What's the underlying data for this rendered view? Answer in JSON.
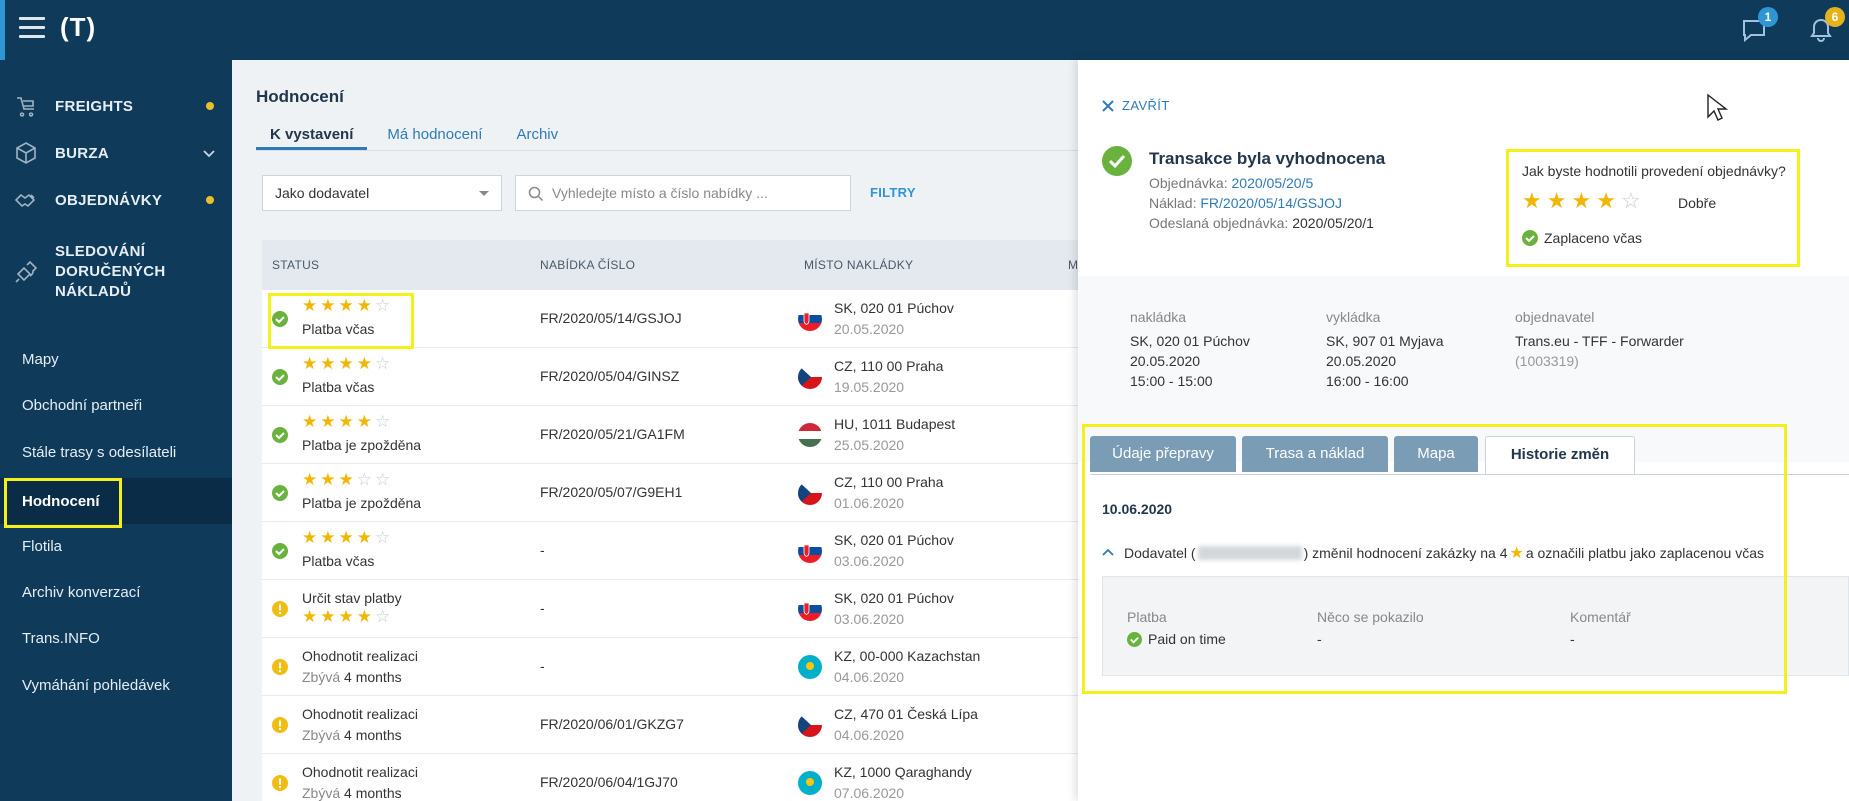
{
  "header": {
    "logo": "(T)",
    "messages_count": "1",
    "notifications_count": "6"
  },
  "sidebar": {
    "main_items": [
      {
        "label": "FREIGHTS",
        "icon": "truck-icon",
        "dot": true
      },
      {
        "label": "BURZA",
        "icon": "box-icon",
        "chevron": true
      },
      {
        "label": "OBJEDNÁVKY",
        "icon": "handshake-icon",
        "dot": true
      },
      {
        "label_lines": [
          "SLEDOVÁNÍ",
          "DORUČENÝCH",
          "NÁKLADŮ"
        ],
        "icon": "satellite-icon"
      }
    ],
    "sub_items": [
      "Mapy",
      "Obchodní partneři",
      "Stále trasy s odesílateli",
      "Hodnocení",
      "Flotila",
      "Archiv konverzací",
      "Trans.INFO",
      "Vymáhání pohledávek"
    ],
    "active_item": "Hodnocení"
  },
  "main": {
    "title": "Hodnocení",
    "tabs": [
      "K vystavení",
      "Má hodnocení",
      "Archiv"
    ],
    "role_select": "Jako dodavatel",
    "search_placeholder": "Vyhledejte místo a číslo nabídky ...",
    "filters_label": "FILTRY",
    "columns": [
      "STATUS",
      "NABÍDKA ČÍSLO",
      "MÍSTO NAKLÁDKY",
      "M"
    ],
    "rows": [
      {
        "status_icon": "check-circle-icon",
        "stars": 4,
        "status_text": "Platba včas",
        "offer": "FR/2020/05/14/GSJOJ",
        "flag": "sk",
        "location": "SK, 020 01 Púchov",
        "date": "20.05.2020",
        "next_flag": "sk"
      },
      {
        "status_icon": "check-circle-icon",
        "stars": 4,
        "status_text": "Platba včas",
        "offer": "FR/2020/05/04/GINSZ",
        "flag": "cz",
        "location": "CZ, 110 00 Praha",
        "date": "19.05.2020",
        "next_flag": "cz"
      },
      {
        "status_icon": "check-circle-icon",
        "stars": 4,
        "status_text": "Platba je zpožděna",
        "offer": "FR/2020/05/21/GA1FM",
        "flag": "hu",
        "location": "HU, 1011 Budapest",
        "date": "25.05.2020",
        "next_flag": "cz"
      },
      {
        "status_icon": "check-circle-icon",
        "stars": 3,
        "status_text": "Platba je zpožděna",
        "offer": "FR/2020/05/07/G9EH1",
        "flag": "cz",
        "location": "CZ, 110 00 Praha",
        "date": "01.06.2020",
        "next_flag": "kz"
      },
      {
        "status_icon": "check-circle-icon",
        "stars": 4,
        "status_text": "Platba včas",
        "offer": "-",
        "flag": "sk",
        "location": "SK, 020 01 Púchov",
        "date": "03.06.2020",
        "next_flag": "cz"
      },
      {
        "status_icon": "warning-circle-icon",
        "stars": 4,
        "status_text": "Určit stav platby",
        "stars_below": true,
        "offer": "-",
        "flag": "sk",
        "location": "SK, 020 01 Púchov",
        "date": "03.06.2020",
        "next_flag": "sk"
      },
      {
        "status_icon": "warning-circle-icon",
        "stars": 0,
        "status_text": "Ohodnotit realizaci",
        "remaining_label": "Zbývá",
        "remaining_value": "4 months",
        "offer": "-",
        "flag": "kz",
        "location": "KZ, 00-000 Kazachstan",
        "date": "04.06.2020",
        "next_flag": "kz"
      },
      {
        "status_icon": "warning-circle-icon",
        "stars": 0,
        "status_text": "Ohodnotit realizaci",
        "remaining_label": "Zbývá",
        "remaining_value": "4 months",
        "offer": "FR/2020/06/01/GKZG7",
        "flag": "cz",
        "location": "CZ, 470 01 Česká Lípa",
        "date": "04.06.2020",
        "next_flag": "cz"
      },
      {
        "status_icon": "warning-circle-icon",
        "stars": 0,
        "status_text": "Ohodnotit realizaci",
        "remaining_label": "Zbývá",
        "remaining_value": "4 months",
        "offer": "FR/2020/06/04/1GJ70",
        "flag": "kz",
        "location": "KZ, 1000 Qaraghandy",
        "date": "07.06.2020",
        "next_flag": "kz"
      }
    ]
  },
  "panel": {
    "close_label": "ZAVŘÍT",
    "title": "Transakce byla vyhodnocena",
    "order_label": "Objednávka:",
    "order_value": "2020/05/20/5",
    "cargo_label": "Náklad:",
    "cargo_value": "FR/2020/05/14/GSJOJ",
    "sent_label": "Odeslaná objednávka:",
    "sent_value": "2020/05/20/1",
    "rating": {
      "question": "Jak byste hodnotili provedení objednávky?",
      "stars": 4,
      "max_stars": 5,
      "word": "Dobře",
      "paid_text": "Zaplaceno včas"
    },
    "loading": {
      "label": "nakládka",
      "place": "SK, 020 01 Púchov",
      "date": "20.05.2020",
      "time": "15:00 - 15:00"
    },
    "unloading": {
      "label": "vykládka",
      "place": "SK, 907 01 Myjava",
      "date": "20.05.2020",
      "time": "16:00 - 16:00"
    },
    "orderer": {
      "label": "objednavatel",
      "name": "Trans.eu - TFF - Forwarder",
      "id": "(1003319)"
    },
    "tabs": [
      "Údaje přepravy",
      "Trasa a náklad",
      "Mapa",
      "Historie změn"
    ],
    "active_tab": "Historie změn",
    "history": {
      "date": "10.06.2020",
      "entry_prefix": "Dodavatel (",
      "entry_mid": ") změnil hodnocení zakázky na 4",
      "entry_suffix": "a označili platbu jako zaplacenou včas",
      "details": [
        {
          "label": "Platba",
          "value": "Paid on time",
          "icon": "check-circle-icon"
        },
        {
          "label": "Něco se pokazilo",
          "value": "-"
        },
        {
          "label": "Komentář",
          "value": "-"
        }
      ]
    }
  },
  "colors": {
    "topbar": "#0f3a5a",
    "accent": "#2f96d6",
    "star": "#f2b705",
    "ok": "#6ab23e",
    "warn": "#f0bd14",
    "highlight": "#f5ef1a"
  }
}
